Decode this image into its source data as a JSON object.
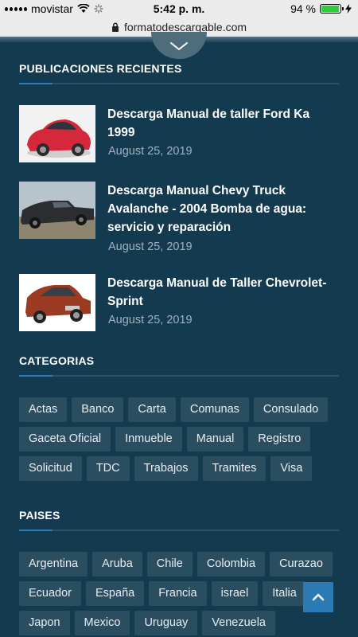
{
  "status": {
    "carrier": "movistar",
    "time": "5:42 p. m.",
    "battery_percent": "94 %",
    "battery_level": 0.94
  },
  "browser": {
    "url": "formatodescargable.com"
  },
  "recent": {
    "heading": "PUBLICACIONES RECIENTES",
    "posts": [
      {
        "title": "Descarga Manual de taller Ford Ka 1999",
        "date": "August 25, 2019"
      },
      {
        "title": "Descarga Manual Chevy Truck Avalanche - 2004 Bomba de agua: servicio y reparación",
        "date": "August 25, 2019"
      },
      {
        "title": "Descarga Manual de Taller Chevrolet-Sprint",
        "date": "August 25, 2019"
      }
    ]
  },
  "categories": {
    "heading": "CATEGORIAS",
    "tags": [
      "Actas",
      "Banco",
      "Carta",
      "Comunas",
      "Consulado",
      "Gaceta Oficial",
      "Inmueble",
      "Manual",
      "Registro",
      "Solicitud",
      "TDC",
      "Trabajos",
      "Tramites",
      "Visa"
    ]
  },
  "countries": {
    "heading": "PAISES",
    "tags": [
      "Argentina",
      "Aruba",
      "Chile",
      "Colombia",
      "Curazao",
      "Ecuador",
      "España",
      "Francia",
      "israel",
      "Italia",
      "Japon",
      "Mexico",
      "Uruguay",
      "Venezuela"
    ]
  },
  "colors": {
    "background": "#143a4f",
    "accent": "#2e7cb6",
    "tag_bg": "#2a4d60"
  }
}
